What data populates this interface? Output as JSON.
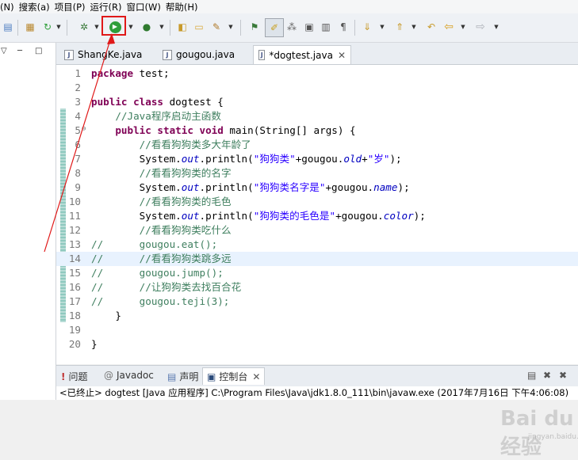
{
  "menu": [
    "(N)",
    "搜索(a)",
    "项目(P)",
    "运行(R)",
    "窗口(W)",
    "帮助(H)"
  ],
  "left_panel": {
    "minimize_icon": "▽",
    "maximize_icon": "□"
  },
  "tabs": [
    {
      "label": "ShangKe.java",
      "active": false
    },
    {
      "label": "gougou.java",
      "active": false
    },
    {
      "label": "*dogtest.java",
      "active": true,
      "close": "✕"
    }
  ],
  "code_lines": [
    {
      "n": "1",
      "html": "<span class='kw'>package</span> test;"
    },
    {
      "n": "2",
      "html": ""
    },
    {
      "n": "3",
      "html": "<span class='kw'>public class</span> dogtest {"
    },
    {
      "n": "4",
      "html": "    <span class='cm'>//Java程序启动主函数</span>"
    },
    {
      "n": "5",
      "html": "    <span class='kw'>public static void</span> main(String[] args) {",
      "fold": "⊖"
    },
    {
      "n": "6",
      "html": "        <span class='cm'>//看看狗狗类多大年龄了</span>"
    },
    {
      "n": "7",
      "html": "        System.<span class='fd'>out</span>.println(<span class='st'>\"狗狗类\"</span>+gougou.<span class='fd'>old</span>+<span class='st'>\"岁\"</span>);"
    },
    {
      "n": "8",
      "html": "        <span class='cm'>//看看狗狗类的名字</span>"
    },
    {
      "n": "9",
      "html": "        System.<span class='fd'>out</span>.println(<span class='st'>\"狗狗类名字是\"</span>+gougou.<span class='fd'>name</span>);"
    },
    {
      "n": "10",
      "html": "        <span class='cm'>//看看狗狗类的毛色</span>"
    },
    {
      "n": "11",
      "html": "        System.<span class='fd'>out</span>.println(<span class='st'>\"狗狗类的毛色是\"</span>+gougou.<span class='fd'>color</span>);"
    },
    {
      "n": "12",
      "html": "        <span class='cm'>//看看狗狗类吃什么</span>"
    },
    {
      "n": "13",
      "html": "<span class='cm'>//      gougou.eat();</span>"
    },
    {
      "n": "14",
      "html": "<span class='cm'>//      //看看狗狗类跳多远</span>",
      "current": true
    },
    {
      "n": "15",
      "html": "<span class='cm'>//      gougou.jump();</span>"
    },
    {
      "n": "16",
      "html": "<span class='cm'>//      //让狗狗类去找百合花</span>"
    },
    {
      "n": "17",
      "html": "<span class='cm'>//      gougou.teji(3);</span>"
    },
    {
      "n": "18",
      "html": "    }"
    },
    {
      "n": "19",
      "html": ""
    },
    {
      "n": "20",
      "html": "}"
    }
  ],
  "bottom_tabs": [
    {
      "label": "问题",
      "icon": "!"
    },
    {
      "label": "Javadoc",
      "icon": "@"
    },
    {
      "label": "声明",
      "icon": "▤"
    },
    {
      "label": "控制台",
      "icon": "▣",
      "active": true,
      "close": "✕"
    }
  ],
  "console_text": "<已终止> dogtest [Java 应用程序] C:\\Program Files\\Java\\jdk1.8.0_111\\bin\\javaw.exe (2017年7月16日 下午4:06:08)",
  "watermark": "Bai du 经验",
  "watermark_sub": "jingyan.baidu.com",
  "colors": {
    "keyword": "#7f0055",
    "comment": "#3f7f5f",
    "string": "#2a00ff",
    "field": "#0000c0",
    "annotation": "#e01818"
  }
}
